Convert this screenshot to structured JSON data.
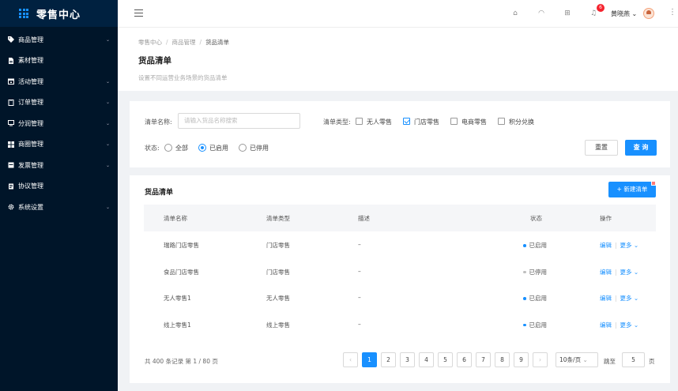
{
  "app": {
    "title": "零售中心"
  },
  "sidebar": {
    "items": [
      {
        "label": "商品管理",
        "icon": "tag-icon",
        "has_arrow": true
      },
      {
        "label": "素材管理",
        "icon": "file-icon",
        "has_arrow": false
      },
      {
        "label": "活动管理",
        "icon": "calendar-icon",
        "has_arrow": true
      },
      {
        "label": "订单管理",
        "icon": "order-icon",
        "has_arrow": true
      },
      {
        "label": "分润管理",
        "icon": "monitor-icon",
        "has_arrow": true
      },
      {
        "label": "商圈管理",
        "icon": "grid-icon",
        "has_arrow": true
      },
      {
        "label": "发票管理",
        "icon": "invoice-icon",
        "has_arrow": true
      },
      {
        "label": "协议管理",
        "icon": "contract-icon",
        "has_arrow": false
      },
      {
        "label": "系统设置",
        "icon": "gear-icon",
        "has_arrow": true
      }
    ]
  },
  "header": {
    "notification_count": "6",
    "username": "黄晓燕"
  },
  "breadcrumb": [
    "零售中心",
    "商品管理",
    "货品清单"
  ],
  "page": {
    "title": "货品清单",
    "description": "设置不同运营业务场景的货品清单"
  },
  "filter": {
    "name_label": "清单名称:",
    "name_placeholder": "请输入货品名称搜索",
    "type_label": "清单类型:",
    "types": [
      {
        "label": "无人零售",
        "checked": false
      },
      {
        "label": "门店零售",
        "checked": true
      },
      {
        "label": "电商零售",
        "checked": false
      },
      {
        "label": "积分兑换",
        "checked": false
      }
    ],
    "status_label": "状态:",
    "statuses": [
      {
        "label": "全部",
        "selected": false
      },
      {
        "label": "已启用",
        "selected": true
      },
      {
        "label": "已停用",
        "selected": false
      }
    ],
    "reset_label": "重置",
    "query_label": "查 询"
  },
  "table": {
    "title": "货品清单",
    "new_button": "+  新建清单",
    "columns": [
      "清单名称",
      "清单类型",
      "描述",
      "状态",
      "操作"
    ],
    "rows": [
      {
        "name": "瑞路门店零售",
        "type": "门店零售",
        "desc": "–",
        "status": "已启用",
        "status_color": "#1890ff"
      },
      {
        "name": "食品门店零售",
        "type": "门店零售",
        "desc": "–",
        "status": "已停用",
        "status_color": "#bfbfbf"
      },
      {
        "name": "无人零售1",
        "type": "无人零售",
        "desc": "–",
        "status": "已启用",
        "status_color": "#1890ff"
      },
      {
        "name": "线上零售1",
        "type": "线上零售",
        "desc": "–",
        "status": "已启用",
        "status_color": "#1890ff"
      }
    ],
    "edit_label": "编辑",
    "more_label": "更多"
  },
  "pagination": {
    "total_text": "共 400 条记录 第 1 / 80 页",
    "pages": [
      "1",
      "2",
      "3",
      "4",
      "5",
      "6",
      "7",
      "8",
      "9"
    ],
    "current": "1",
    "page_size": "10条/页",
    "jump_label": "跳至",
    "jump_value": "5",
    "jump_unit": "页"
  },
  "colors": {
    "primary": "#1890ff",
    "sidebar_bg": "#001529"
  }
}
